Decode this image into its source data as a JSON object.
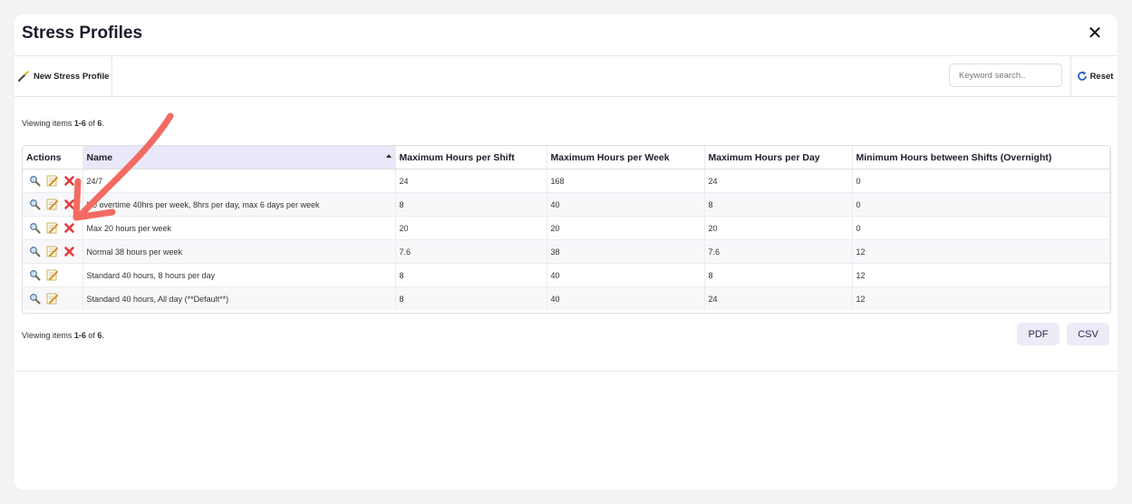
{
  "dialog": {
    "title": "Stress Profiles",
    "close_glyph": "✕"
  },
  "toolbar": {
    "new_label": "New Stress Profile",
    "new_icon": "magic-wand-icon",
    "search_placeholder": "Keyword search..",
    "search_value": "",
    "reset_label": "Reset",
    "reset_icon": "refresh-icon"
  },
  "summary_top": {
    "prefix": "Viewing items ",
    "range": "1-6",
    "mid": " of ",
    "total": "6",
    "suffix": "."
  },
  "summary_bottom": {
    "prefix": "Viewing items ",
    "range": "1-6",
    "mid": " of ",
    "total": "6",
    "suffix": "."
  },
  "table": {
    "columns": [
      "Actions",
      "Name",
      "Maximum Hours per Shift",
      "Maximum Hours per Week",
      "Maximum Hours per Day",
      "Minimum Hours between Shifts (Overnight)"
    ],
    "sorted_column": "Name",
    "rows": [
      {
        "name": "24/7",
        "shift": "24",
        "week": "168",
        "day": "24",
        "between": "0",
        "deletable": true
      },
      {
        "name": "No overtime 40hrs per week, 8hrs per day, max 6 days per week",
        "shift": "8",
        "week": "40",
        "day": "8",
        "between": "0",
        "deletable": true
      },
      {
        "name": "Max 20 hours per week",
        "shift": "20",
        "week": "20",
        "day": "20",
        "between": "0",
        "deletable": true
      },
      {
        "name": "Normal 38 hours per week",
        "shift": "7.6",
        "week": "38",
        "day": "7.6",
        "between": "12",
        "deletable": true
      },
      {
        "name": "Standard 40 hours, 8 hours per day",
        "shift": "8",
        "week": "40",
        "day": "8",
        "between": "12",
        "deletable": false
      },
      {
        "name": "Standard 40 hours, All day (**Default**)",
        "shift": "8",
        "week": "40",
        "day": "24",
        "between": "12",
        "deletable": false
      }
    ]
  },
  "export": {
    "pdf_label": "PDF",
    "csv_label": "CSV"
  },
  "colors": {
    "accent": "#f26b63",
    "sorted_header": "#e9e8f8",
    "export_bg": "#ecebf6"
  }
}
